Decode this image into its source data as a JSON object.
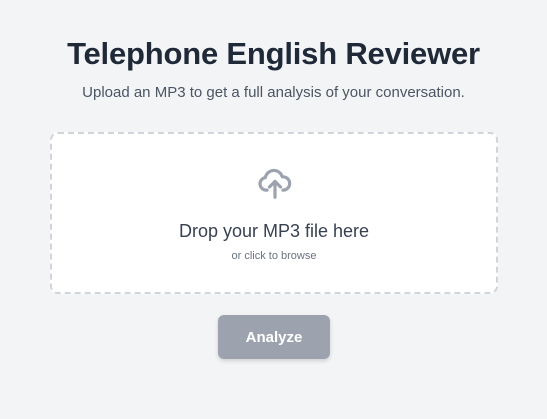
{
  "page": {
    "title": "Telephone English Reviewer",
    "subtitle": "Upload an MP3 to get a full analysis of your conversation."
  },
  "dropzone": {
    "icon": "cloud-upload-icon",
    "title": "Drop your MP3 file here",
    "hint": "or click to browse"
  },
  "actions": {
    "analyze_label": "Analyze",
    "analyze_disabled": true
  },
  "colors": {
    "background": "#f3f4f6",
    "title_text": "#1f2937",
    "dropzone_border": "#d1d5db",
    "icon": "#9ca3af",
    "button_disabled": "#9ca3af"
  }
}
